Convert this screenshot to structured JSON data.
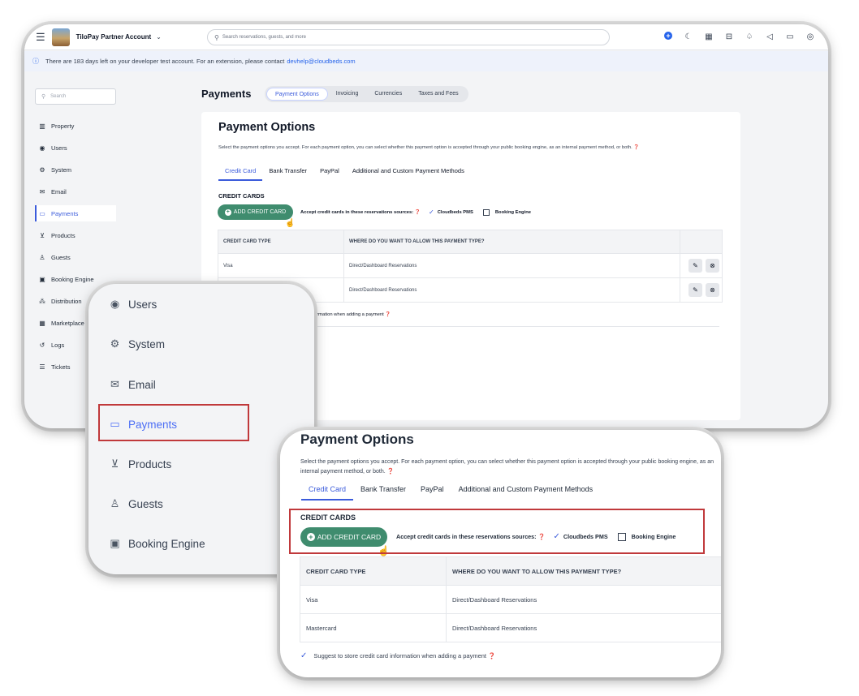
{
  "topbar": {
    "account_name": "TiloPay Partner Account",
    "search_placeholder": "Search reservations, guests, and more"
  },
  "notice": {
    "text": "There are 183 days left on your developer test account. For an extension, please contact",
    "link": "devhelp@cloudbeds.com"
  },
  "sidebar": {
    "search_placeholder": "Search",
    "items": [
      {
        "label": "Property",
        "icon": "building-icon"
      },
      {
        "label": "Users",
        "icon": "user-circle-icon"
      },
      {
        "label": "System",
        "icon": "gear-icon"
      },
      {
        "label": "Email",
        "icon": "envelope-icon"
      },
      {
        "label": "Payments",
        "icon": "credit-card-icon"
      },
      {
        "label": "Products",
        "icon": "cart-icon"
      },
      {
        "label": "Guests",
        "icon": "person-icon"
      },
      {
        "label": "Booking Engine",
        "icon": "calendar-check-icon"
      },
      {
        "label": "Distribution",
        "icon": "sitemap-icon"
      },
      {
        "label": "Marketplace",
        "icon": "grid-icon"
      },
      {
        "label": "Logs",
        "icon": "history-icon"
      },
      {
        "label": "Tickets",
        "icon": "list-icon"
      }
    ]
  },
  "page": {
    "title": "Payments",
    "tabs": [
      "Payment Options",
      "Invoicing",
      "Currencies",
      "Taxes and Fees"
    ],
    "active_tab": "Payment Options"
  },
  "payment_options": {
    "title": "Payment Options",
    "description": "Select the payment options you accept. For each payment option, you can select whether this payment option is accepted through your public booking engine, as an internal payment method, or both.",
    "description_zoom": "Select the payment options you accept. For each payment option, you can select whether this payment option is accepted through your public booking engine, as an internal payment method, or both.",
    "subtabs": [
      "Credit Card",
      "Bank Transfer",
      "PayPal",
      "Additional and Custom Payment Methods"
    ],
    "section_title": "CREDIT CARDS",
    "add_button": "ADD CREDIT CARD",
    "accept_label": "Accept credit cards in these reservations sources:",
    "source_pms": "Cloudbeds PMS",
    "source_pms_checked": true,
    "source_booking_engine": "Booking Engine",
    "source_booking_engine_checked": false,
    "table_headers": [
      "CREDIT CARD TYPE",
      "WHERE DO YOU WANT TO ALLOW THIS PAYMENT TYPE?"
    ],
    "rows": [
      {
        "type": "Visa",
        "where": "Direct/Dashboard Reservations"
      },
      {
        "type": "Mastercard",
        "where": "Direct/Dashboard Reservations"
      }
    ],
    "suggest_partial": "ormation when adding a payment",
    "suggest_full": "Suggest to store credit card information when adding a payment"
  },
  "zoom_sidebar": {
    "items": [
      {
        "label": "Users",
        "icon": "user-circle-icon"
      },
      {
        "label": "System",
        "icon": "gear-icon"
      },
      {
        "label": "Email",
        "icon": "envelope-icon"
      },
      {
        "label": "Payments",
        "icon": "credit-card-icon"
      },
      {
        "label": "Products",
        "icon": "cart-icon"
      },
      {
        "label": "Guests",
        "icon": "person-icon"
      },
      {
        "label": "Booking Engine",
        "icon": "calendar-check-icon"
      }
    ],
    "active": "Payments"
  },
  "colors": {
    "accent": "#3b5bdb",
    "add_button": "#3f8c6e",
    "highlight": "#c0393b"
  }
}
